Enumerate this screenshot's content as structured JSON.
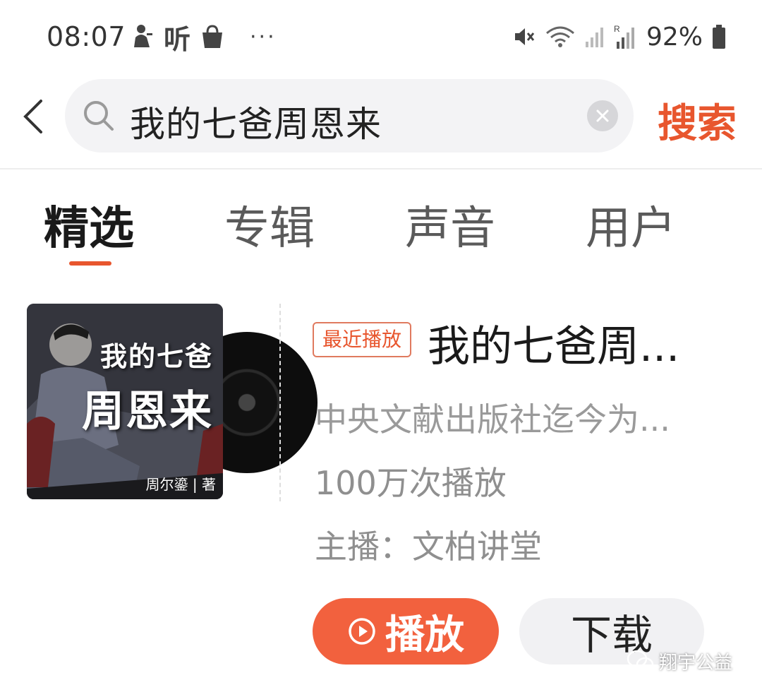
{
  "status_bar": {
    "time": "08:07",
    "listen_glyph": "听",
    "more": "···",
    "battery": "92%",
    "icons": [
      "person-notification-icon",
      "shopping-bag-icon",
      "mute-icon",
      "wifi-icon",
      "signal-icon",
      "roaming-signal-icon",
      "battery-icon"
    ]
  },
  "search": {
    "query": "我的七爸周恩来",
    "submit_label": "搜索"
  },
  "tabs": [
    {
      "label": "精选",
      "active": true
    },
    {
      "label": "专辑",
      "active": false
    },
    {
      "label": "声音",
      "active": false
    },
    {
      "label": "用户",
      "active": false
    }
  ],
  "album": {
    "cover_title_line1": "我的七爸",
    "cover_title_line2": "周恩来",
    "cover_author": "周尔鎏 | 著",
    "badge": "最近播放",
    "title": "我的七爸周...",
    "description": "中央文献出版社迄今为...",
    "plays": "100万次播放",
    "host_label": "主播：",
    "host_name": "文柏讲堂",
    "play_label": "播放",
    "download_label": "下载"
  },
  "watermark": {
    "text": "翔宇公益"
  },
  "colors": {
    "accent": "#e8562e",
    "play_button": "#f2613e",
    "muted_text": "#9a9a9a"
  }
}
